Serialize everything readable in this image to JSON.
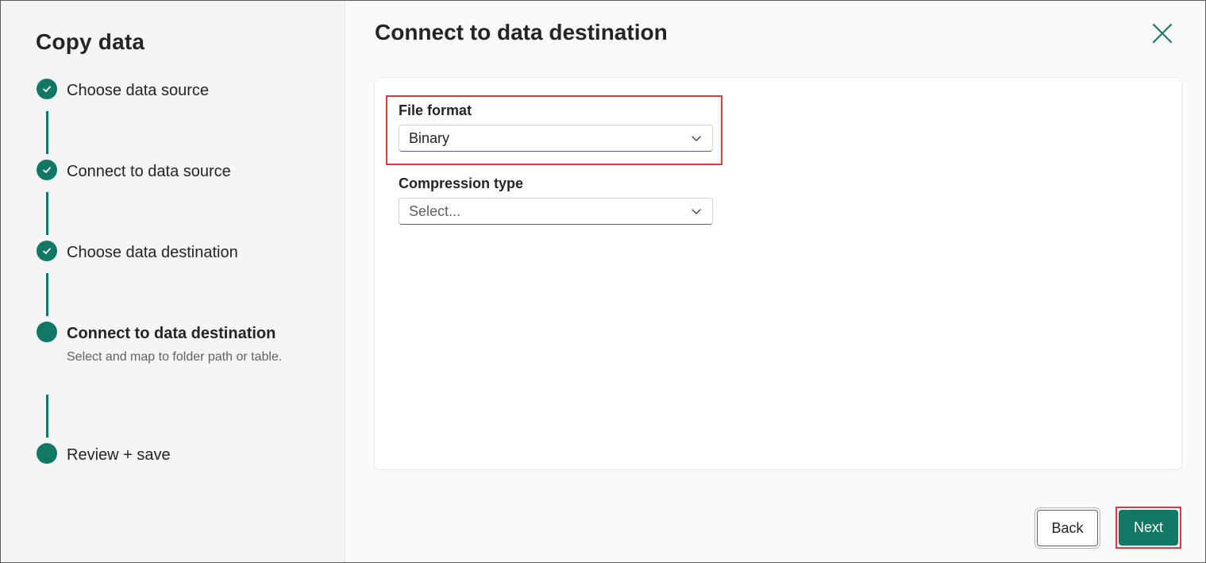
{
  "sidebar": {
    "title": "Copy data",
    "steps": [
      {
        "label": "Choose data source",
        "status": "completed"
      },
      {
        "label": "Connect to data source",
        "status": "completed"
      },
      {
        "label": "Choose data destination",
        "status": "completed"
      },
      {
        "label": "Connect to data destination",
        "status": "current",
        "description": "Select and map to folder path or table."
      },
      {
        "label": "Review + save",
        "status": "pending"
      }
    ]
  },
  "main": {
    "title": "Connect to data destination",
    "fields": {
      "file_format": {
        "label": "File format",
        "value": "Binary"
      },
      "compression_type": {
        "label": "Compression type",
        "placeholder": "Select..."
      }
    }
  },
  "footer": {
    "back_label": "Back",
    "next_label": "Next"
  },
  "colors": {
    "accent": "#117865",
    "highlight": "#e2393f"
  },
  "icons": {
    "step_completed": "checkmark-icon",
    "close": "close-icon",
    "dropdown": "chevron-down-icon"
  }
}
